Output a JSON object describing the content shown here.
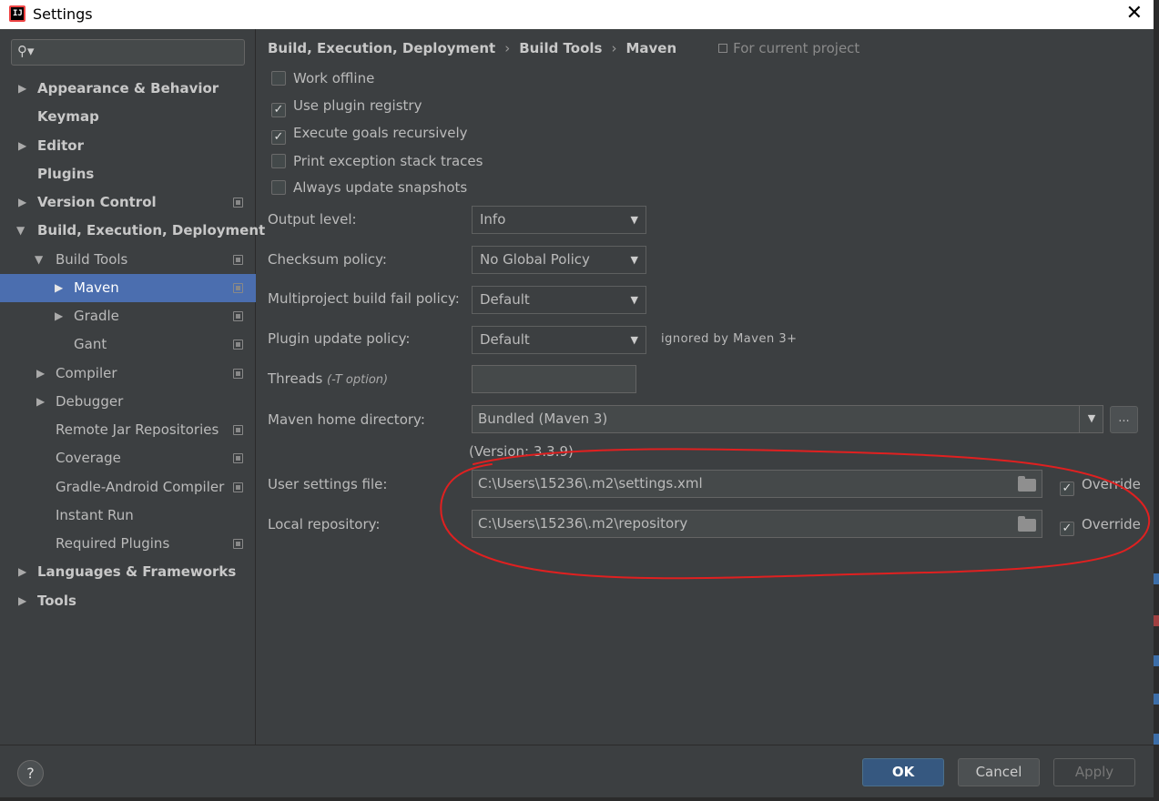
{
  "window": {
    "title": "Settings",
    "app_icon": "IJ"
  },
  "search": {
    "placeholder": ""
  },
  "sidebar": {
    "items": [
      {
        "label": "Appearance & Behavior",
        "expanded": false,
        "bold": true,
        "project_scoped": false
      },
      {
        "label": "Keymap",
        "bold": true,
        "project_scoped": false
      },
      {
        "label": "Editor",
        "expanded": false,
        "bold": true,
        "project_scoped": false
      },
      {
        "label": "Plugins",
        "bold": true,
        "project_scoped": false
      },
      {
        "label": "Version Control",
        "expanded": false,
        "bold": true,
        "project_scoped": true
      },
      {
        "label": "Build, Execution, Deployment",
        "expanded": true,
        "bold": true,
        "project_scoped": false
      },
      {
        "label": "Build Tools",
        "expanded": true,
        "bold": false,
        "project_scoped": true
      },
      {
        "label": "Maven",
        "expanded": false,
        "selected": true,
        "project_scoped": true
      },
      {
        "label": "Gradle",
        "expanded": false,
        "project_scoped": true
      },
      {
        "label": "Gant",
        "project_scoped": true
      },
      {
        "label": "Compiler",
        "expanded": false,
        "project_scoped": true
      },
      {
        "label": "Debugger",
        "expanded": false,
        "project_scoped": false
      },
      {
        "label": "Remote Jar Repositories",
        "project_scoped": true
      },
      {
        "label": "Coverage",
        "project_scoped": true
      },
      {
        "label": "Gradle-Android Compiler",
        "project_scoped": true
      },
      {
        "label": "Instant Run",
        "project_scoped": false
      },
      {
        "label": "Required Plugins",
        "project_scoped": true
      },
      {
        "label": "Languages & Frameworks",
        "expanded": false,
        "bold": true,
        "project_scoped": false
      },
      {
        "label": "Tools",
        "expanded": false,
        "bold": true,
        "project_scoped": false
      }
    ]
  },
  "breadcrumb": {
    "items": [
      "Build, Execution, Deployment",
      "Build Tools",
      "Maven"
    ],
    "separator": "›",
    "scope": "For current project"
  },
  "options": [
    {
      "label": "Work offline",
      "checked": false
    },
    {
      "label": "Use plugin registry",
      "checked": true
    },
    {
      "label": "Execute goals recursively",
      "checked": true
    },
    {
      "label": "Print exception stack traces",
      "checked": false
    },
    {
      "label": "Always update snapshots",
      "checked": false
    }
  ],
  "form": {
    "output_level": {
      "label": "Output level:",
      "value": "Info"
    },
    "checksum_policy": {
      "label": "Checksum policy:",
      "value": "No Global Policy"
    },
    "multiproject_fail_policy": {
      "label": "Multiproject build fail policy:",
      "value": "Default"
    },
    "plugin_update_policy": {
      "label": "Plugin update policy:",
      "value": "Default",
      "hint": "ignored by Maven 3+"
    },
    "threads": {
      "label": "Threads",
      "hint": "(-T option)",
      "value": ""
    },
    "maven_home": {
      "label": "Maven home directory:",
      "value": "Bundled (Maven 3)",
      "browse_label": "...",
      "version": "(Version: 3.3.9)"
    },
    "user_settings": {
      "label": "User settings file:",
      "value": "C:\\Users\\15236\\.m2\\settings.xml",
      "override_label": "Override",
      "override_checked": true
    },
    "local_repository": {
      "label": "Local repository:",
      "value": "C:\\Users\\15236\\.m2\\repository",
      "override_label": "Override",
      "override_checked": true
    }
  },
  "footer": {
    "help": "?",
    "ok": "OK",
    "cancel": "Cancel",
    "apply": "Apply"
  },
  "colors": {
    "background": "#3c3f41",
    "selection": "#4b6eaf",
    "primary_button": "#365880",
    "annotation": "#e02020"
  },
  "icons": {
    "search": "search-icon",
    "close": "close-icon",
    "project_scope": "project-scope-icon",
    "folder": "folder-icon",
    "expand": "chevron-right-icon",
    "collapse": "chevron-down-icon"
  },
  "annotation": {
    "type": "hand-drawn red ellipse",
    "encloses": "user settings and local repository fields"
  }
}
